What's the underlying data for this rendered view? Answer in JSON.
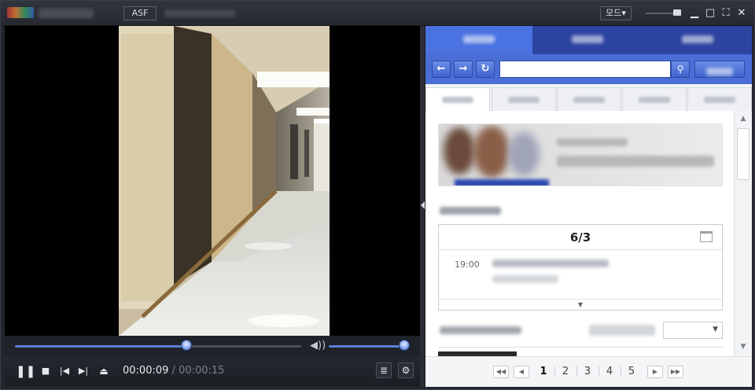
{
  "titlebar": {
    "format": "ASF",
    "mode_label": "모드▾",
    "icons": [
      "minimize-icon",
      "maximize-icon",
      "fullscreen-icon",
      "close-icon"
    ]
  },
  "player": {
    "progress": 0.6,
    "volume": 1.0,
    "current_time": "00:00:09",
    "separator": "/",
    "total_time": "00:00:15",
    "icons": [
      "pause-icon",
      "stop-icon",
      "previous-icon",
      "next-icon",
      "eject-icon",
      "playlist-icon",
      "settings-icon",
      "speaker-icon"
    ]
  },
  "browser": {
    "address_value": "",
    "schedule": {
      "date": "6/3",
      "time": "19:00"
    },
    "pagination": {
      "pages": [
        "1",
        "2",
        "3",
        "4",
        "5"
      ],
      "current": "1"
    }
  },
  "colors": {
    "accent_blue": "#4a6ed6",
    "tab_bar": "#2c43a0",
    "seek_fill": "#5b7fd3"
  }
}
